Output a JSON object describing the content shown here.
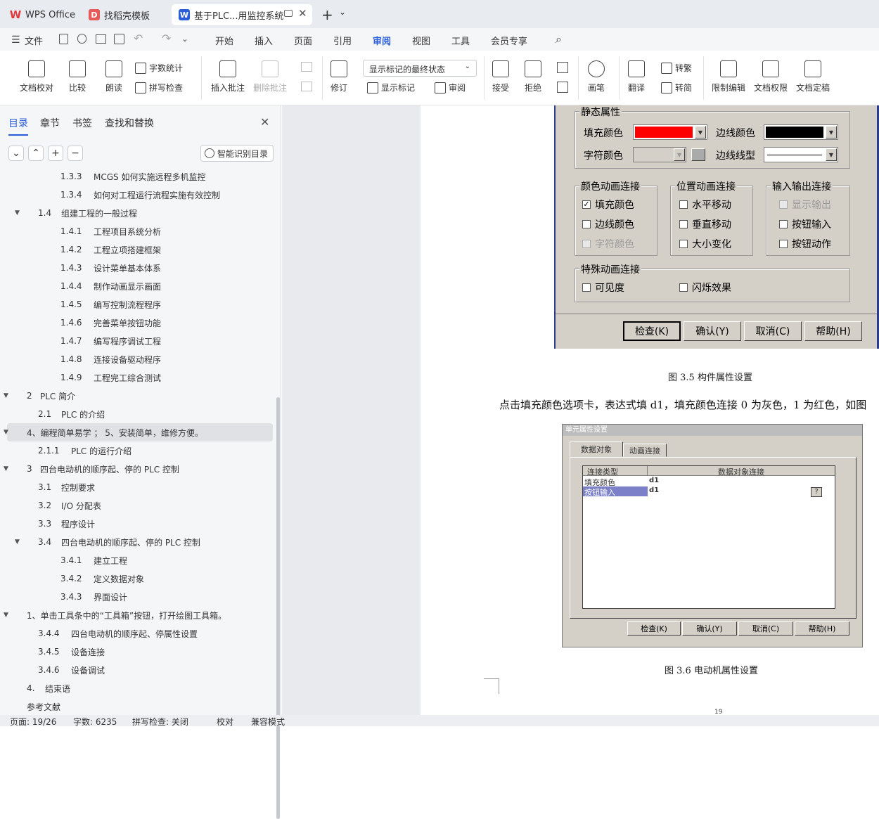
{
  "tabs": [
    {
      "label": "WPS Office",
      "icon": "wps-logo-icon",
      "color": "#e03a3a"
    },
    {
      "label": "找稻壳模板",
      "icon": "docer-icon",
      "color": "#e65a5a"
    },
    {
      "label": "基于PLC...用监控系统",
      "icon": "word-doc-icon",
      "color": "#2b5fd9"
    }
  ],
  "tabbar": {
    "new_tab": "+",
    "new_tab_menu": "⌄"
  },
  "menu": {
    "file": "文件",
    "items": [
      "开始",
      "插入",
      "页面",
      "引用",
      "审阅",
      "视图",
      "工具",
      "会员专享"
    ],
    "active": "审阅"
  },
  "ribbon": {
    "doc_check": "文档校对",
    "compare": "比较",
    "read_aloud": "朗读",
    "word_count": "字数统计",
    "spell_check": "拼写检查",
    "insert_comment": "插入批注",
    "delete_comment": "删除批注",
    "revise": "修订",
    "show_mode": "显示标记的最终状态",
    "show_markup": "显示标记",
    "review": "审阅",
    "accept": "接受",
    "reject": "拒绝",
    "pen": "画笔",
    "translate": "翻译",
    "to_traditional": "转繁",
    "to_simplified": "转简",
    "restrict_edit": "限制编辑",
    "doc_permission": "文档权限",
    "doc_finalize": "文档定稿"
  },
  "panel": {
    "tabs": [
      "目录",
      "章节",
      "书签",
      "查找和替换"
    ],
    "active_tab": "目录",
    "smart_toc": "智能识别目录",
    "toc": [
      {
        "num": "1.3.3",
        "text": "MCGS 如何实施远程多机监控",
        "level": 3
      },
      {
        "num": "1.3.4",
        "text": "如何对工程运行流程实施有效控制",
        "level": 3
      },
      {
        "num": "1.4",
        "text": "组建工程的一般过程",
        "level": 2,
        "caret": "▼"
      },
      {
        "num": "1.4.1",
        "text": "工程项目系统分析",
        "level": 3
      },
      {
        "num": "1.4.2",
        "text": "工程立项搭建框架",
        "level": 3
      },
      {
        "num": "1.4.3",
        "text": "设计菜单基本体系",
        "level": 3
      },
      {
        "num": "1.4.4",
        "text": "制作动画显示画面",
        "level": 3
      },
      {
        "num": "1.4.5",
        "text": "编写控制流程程序",
        "level": 3
      },
      {
        "num": "1.4.6",
        "text": "完善菜单按钮功能",
        "level": 3
      },
      {
        "num": "1.4.7",
        "text": "编写程序调试工程",
        "level": 3
      },
      {
        "num": "1.4.8",
        "text": "连接设备驱动程序",
        "level": 3
      },
      {
        "num": "1.4.9",
        "text": "工程完工综合测试",
        "level": 3
      },
      {
        "num": "2",
        "text": "PLC 简介",
        "level": 1,
        "caret": "▼"
      },
      {
        "num": "2.1",
        "text": "PLC 的介绍",
        "level": 2
      },
      {
        "num": "",
        "text": "4、编程简单易学 ； 5、安装简单，维修方便。",
        "level": 1,
        "caret": "▼",
        "selected": true
      },
      {
        "num": "2.1.1",
        "text": "PLC 的运行介绍",
        "level": 2
      },
      {
        "num": "3",
        "text": "四台电动机的顺序起、停的 PLC 控制",
        "level": 1,
        "caret": "▼"
      },
      {
        "num": "3.1",
        "text": "控制要求",
        "level": 2
      },
      {
        "num": "3.2",
        "text": "I/O 分配表",
        "level": 2
      },
      {
        "num": "3.3",
        "text": "程序设计",
        "level": 2
      },
      {
        "num": "3.4",
        "text": "四台电动机的顺序起、停的 PLC 控制",
        "level": 2,
        "caret": "▼"
      },
      {
        "num": "3.4.1",
        "text": "建立工程",
        "level": 3
      },
      {
        "num": "3.4.2",
        "text": "定义数据对象",
        "level": 3
      },
      {
        "num": "3.4.3",
        "text": "界面设计",
        "level": 3
      },
      {
        "num": "",
        "text": "1、单击工具条中的“工具箱”按钮，打开绘图工具箱。",
        "level": 1,
        "caret": "▼"
      },
      {
        "num": "3.4.4",
        "text": "四台电动机的顺序起、停属性设置",
        "level": 2
      },
      {
        "num": "3.4.5",
        "text": "设备连接",
        "level": 2
      },
      {
        "num": "3.4.6",
        "text": "设备调试",
        "level": 2
      },
      {
        "num": "4.",
        "text": "结束语",
        "level": 1
      },
      {
        "num": "",
        "text": "参考文献",
        "level": 1
      }
    ]
  },
  "dialog1": {
    "static_group": "静态属性",
    "fill_color": "填充颜色",
    "border_color": "边线颜色",
    "char_color": "字符颜色",
    "border_style": "边线线型",
    "fill_swatch": "#ff0000",
    "border_swatch": "#000000",
    "color_group": "颜色动画连接",
    "position_group": "位置动画连接",
    "io_group": "输入输出连接",
    "cb_fill": "填充颜色",
    "cb_border": "边线颜色",
    "cb_char": "字符颜色",
    "cb_hmove": "水平移动",
    "cb_vmove": "垂直移动",
    "cb_resize": "大小变化",
    "cb_show_out": "显示输出",
    "cb_btn_in": "按钮输入",
    "cb_btn_act": "按钮动作",
    "special_group": "特殊动画连接",
    "cb_visible": "可见度",
    "cb_blink": "闪烁效果",
    "check_mark": "✓",
    "btn_check": "检查(K)",
    "btn_ok": "确认(Y)",
    "btn_cancel": "取消(C)",
    "btn_help": "帮助(H)"
  },
  "caption1": "图 3.5  构件属性设置",
  "paragraph": "点击填充颜色选项卡，表达式填 d1，填充颜色连接 0 为灰色，1 为红色，如图",
  "dialog2": {
    "title": "单元属性设置",
    "tab_data": "数据对象",
    "tab_anim": "动画连接",
    "col_type": "连接类型",
    "col_conn": "数据对象连接",
    "rows": [
      {
        "type": "填充颜色",
        "val": "d1"
      },
      {
        "type": "按钮输入",
        "val": "d1"
      }
    ],
    "help_q": "?",
    "btn_check": "检查(K)",
    "btn_ok": "确认(Y)",
    "btn_cancel": "取消(C)",
    "btn_help": "帮助(H)"
  },
  "caption2": "图 3.6 电动机属性设置",
  "page_number": "19",
  "status": {
    "page": "页面: 19/26",
    "words": "字数: 6235",
    "spell": "拼写检查: 关闭",
    "proof": "校对",
    "compat": "兼容模式"
  }
}
